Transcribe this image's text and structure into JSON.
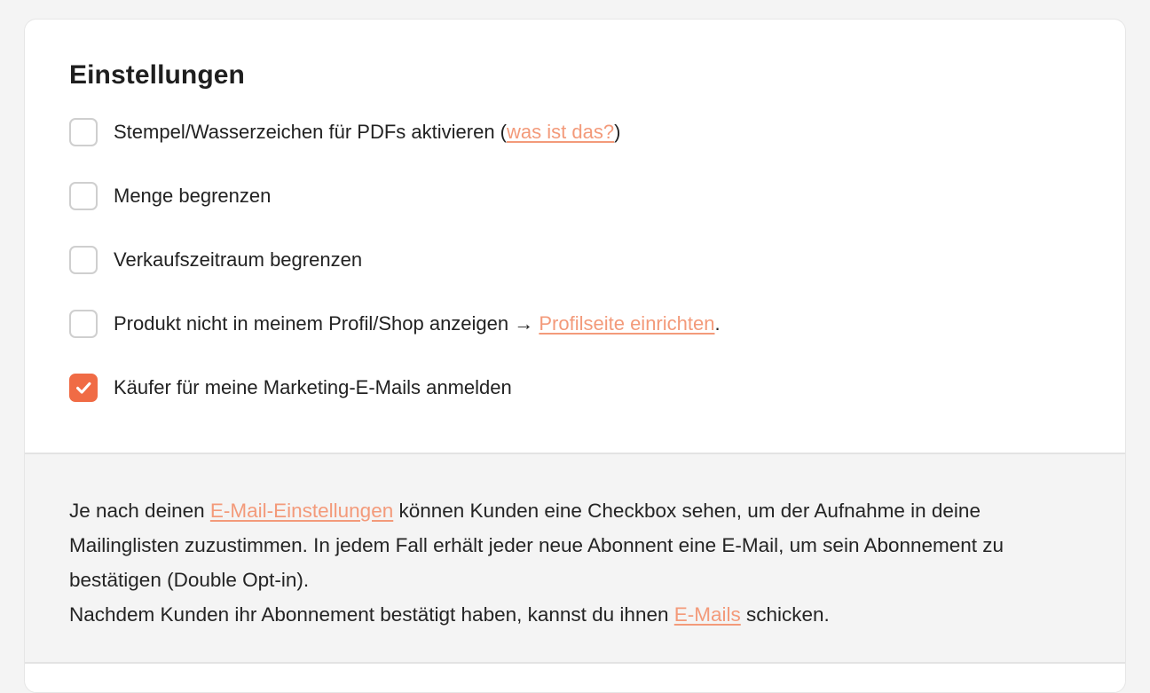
{
  "settings": {
    "title": "Einstellungen",
    "options": [
      {
        "before": "Stempel/Wasserzeichen für PDFs aktivieren (",
        "link": "was ist das?",
        "after": ")",
        "checked": false
      },
      {
        "label": "Menge begrenzen",
        "checked": false
      },
      {
        "label": "Verkaufszeitraum begrenzen",
        "checked": false
      },
      {
        "before": "Produkt nicht in meinem Profil/Shop anzeigen → ",
        "link": "Profilseite einrichten",
        "after": ".",
        "checked": false
      },
      {
        "label": "Käufer für meine Marketing-E-Mails anmelden",
        "checked": true
      }
    ]
  },
  "info": {
    "p1_before": "Je nach deinen ",
    "p1_link": "E-Mail-Einstellungen",
    "p1_after": " können Kunden eine Checkbox sehen, um der Aufnahme in deine Mailinglisten zuzustimmen. In jedem Fall erhält jeder neue Abonnent eine E-Mail, um sein Abonnement zu bestätigen (Double Opt-in).",
    "p2_before": "Nachdem Kunden ihr Abonnement bestätigt haben, kannst du ihnen ",
    "p2_link": "E-Mails",
    "p2_after": " schicken."
  },
  "colors": {
    "accent": "#f06b45",
    "link": "#f39a7a",
    "background": "#f4f4f4",
    "card": "#ffffff"
  },
  "icons": {
    "check": "checkmark-icon"
  }
}
